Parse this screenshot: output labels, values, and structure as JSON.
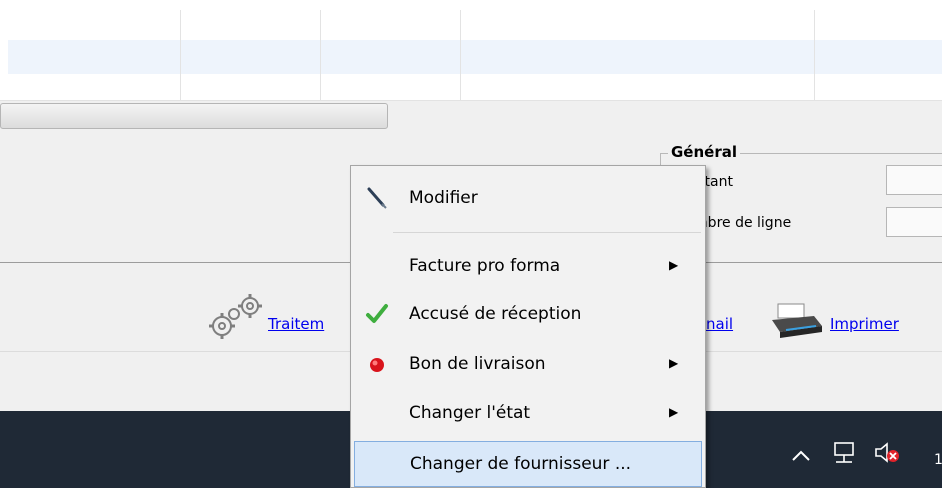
{
  "general": {
    "title": "Général",
    "montant_label": "Montant",
    "nombre_lignes_label": "Nombre de ligne"
  },
  "actions": {
    "traitement": "Traitem",
    "mail": "nail",
    "imprimer": "Imprimer"
  },
  "context_menu": {
    "items": [
      {
        "label": "Modifier",
        "icon": "pen-icon",
        "submenu": false
      },
      {
        "label": "Facture pro forma",
        "icon": "",
        "submenu": true
      },
      {
        "label": "Accusé de réception",
        "icon": "checkmark-icon",
        "submenu": false
      },
      {
        "label": "Bon de livraison",
        "icon": "red-dot-icon",
        "submenu": true
      },
      {
        "label": "Changer l'état",
        "icon": "",
        "submenu": true
      },
      {
        "label": "Changer de fournisseur ...",
        "icon": "",
        "submenu": false,
        "highlighted": true
      }
    ]
  },
  "tray": {
    "chevron": "^",
    "network_icon": "network-icon",
    "volume_icon": "volume-muted-icon"
  },
  "colors": {
    "taskbar": "#1f2936",
    "highlight": "#d9e8f9",
    "link": "#0000ee",
    "row_highlight": "#eef4fc"
  }
}
